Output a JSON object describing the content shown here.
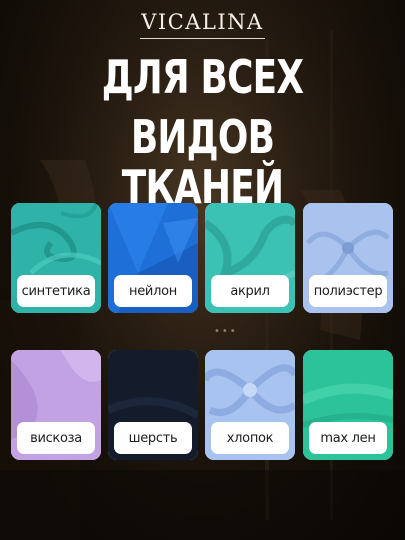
{
  "brand": "VICALINA",
  "headline": {
    "line1": "ДЛЯ ВСЕХ",
    "line2": "ВИДОВ ТКАНЕЙ"
  },
  "fabrics": [
    {
      "label": "синтетика",
      "color": "#2fb3a8"
    },
    {
      "label": "нейлон",
      "color": "#1f6fd8"
    },
    {
      "label": "акрил",
      "color": "#3cc1b5"
    },
    {
      "label": "полиэстер",
      "color": "#a9c2ee"
    },
    {
      "label": "вискоза",
      "color": "#c3a2e3"
    },
    {
      "label": "шерсть",
      "color": "#141c2c"
    },
    {
      "label": "хлопок",
      "color": "#a8c3ef"
    },
    {
      "label": "max лен",
      "color": "#2dc39a"
    }
  ]
}
